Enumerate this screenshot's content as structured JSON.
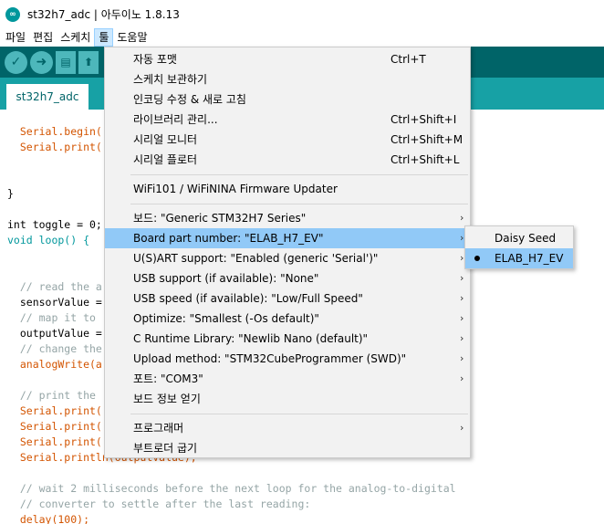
{
  "window": {
    "title": "st32h7_adc | 아두이노 1.8.13",
    "icon": "arduino-icon"
  },
  "menubar": {
    "items": [
      "파일",
      "편집",
      "스케치",
      "툴",
      "도움말"
    ],
    "active": "툴"
  },
  "toolbar": {
    "buttons": [
      "verify-icon",
      "upload-icon",
      "new-icon",
      "open-icon"
    ]
  },
  "tabs": [
    {
      "label": "st32h7_adc"
    }
  ],
  "editor": {
    "lines": [
      {
        "text": "  Serial.begin("
      },
      {
        "text": "  Serial.print("
      },
      {
        "text": "}"
      },
      {
        "text": "int toggle = 0;"
      },
      {
        "text": "void loop() {"
      },
      {
        "text": "  // read the a"
      },
      {
        "text": "  sensorValue ="
      },
      {
        "text": "  // map it to"
      },
      {
        "text": "  outputValue ="
      },
      {
        "text": "  // change the"
      },
      {
        "text": "  analogWrite(a"
      },
      {
        "text": "  // print the"
      },
      {
        "text": "  Serial.print("
      },
      {
        "text": "  Serial.print("
      },
      {
        "text": "  Serial.print("
      },
      {
        "text": "  Serial.println(outputValue);"
      },
      {
        "text": "  // wait 2 milliseconds before the next loop for the analog-to-digital"
      },
      {
        "text": "  // converter to settle after the last reading:"
      },
      {
        "text": "  delay(100);"
      }
    ]
  },
  "tools_menu": {
    "items": [
      {
        "label": "자동 포맷",
        "shortcut": "Ctrl+T"
      },
      {
        "label": "스케치 보관하기",
        "shortcut": ""
      },
      {
        "label": "인코딩 수정 & 새로 고침",
        "shortcut": ""
      },
      {
        "label": "라이브러리 관리...",
        "shortcut": "Ctrl+Shift+I"
      },
      {
        "label": "시리얼 모니터",
        "shortcut": "Ctrl+Shift+M"
      },
      {
        "label": "시리얼 플로터",
        "shortcut": "Ctrl+Shift+L"
      },
      {
        "label": "WiFi101 / WiFiNINA Firmware Updater",
        "shortcut": ""
      },
      {
        "label": "보드: \"Generic STM32H7 Series\"",
        "submenu": true
      },
      {
        "label": "Board part number: \"ELAB_H7_EV\"",
        "submenu": true,
        "highlighted": true
      },
      {
        "label": "U(S)ART support: \"Enabled (generic 'Serial')\"",
        "submenu": true
      },
      {
        "label": "USB support (if available): \"None\"",
        "submenu": true
      },
      {
        "label": "USB speed (if available): \"Low/Full Speed\"",
        "submenu": true
      },
      {
        "label": "Optimize: \"Smallest (-Os default)\"",
        "submenu": true
      },
      {
        "label": "C Runtime Library: \"Newlib Nano (default)\"",
        "submenu": true
      },
      {
        "label": "Upload method: \"STM32CubeProgrammer (SWD)\"",
        "submenu": true
      },
      {
        "label": "포트: \"COM3\"",
        "submenu": true
      },
      {
        "label": "보드 정보 얻기",
        "shortcut": ""
      },
      {
        "label": "프로그래머",
        "submenu": true
      },
      {
        "label": "부트로더 굽기",
        "shortcut": ""
      }
    ]
  },
  "board_submenu": {
    "items": [
      {
        "label": "Daisy Seed",
        "selected": false
      },
      {
        "label": "ELAB_H7_EV",
        "selected": true
      }
    ]
  },
  "colors": {
    "toolbar": "#006468",
    "tabstrip": "#17a1a5",
    "highlight": "#91c9f7"
  }
}
